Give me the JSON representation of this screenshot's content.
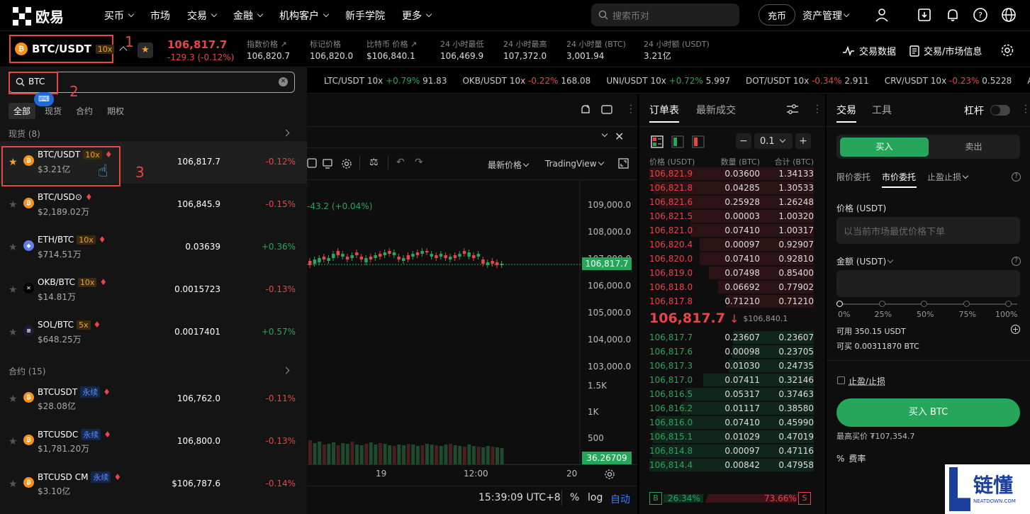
{
  "nav": {
    "brand": "欧易",
    "items": [
      "买币",
      "市场",
      "交易",
      "金融",
      "机构客户",
      "新手学院",
      "更多"
    ],
    "search_placeholder": "搜索币对",
    "charge": "充币",
    "assets": "资产管理"
  },
  "ticker": {
    "pair": "BTC/USDT",
    "leverage": "10x",
    "price": "106,817.7",
    "change": "-129.3 (-0.12%)",
    "stats": [
      {
        "label": "指数价格",
        "value": "106,820.7"
      },
      {
        "label": "标记价格",
        "value": "106,820.0"
      },
      {
        "label": "比特币 价格",
        "value": "$106,840.1"
      },
      {
        "label": "24 小时最低",
        "value": "106,469.9"
      },
      {
        "label": "24 小时最高",
        "value": "107,372.0"
      },
      {
        "label": "24 小时量 (BTC)",
        "value": "3,001.94"
      },
      {
        "label": "24 小时额 (USDT)",
        "value": "3.21亿"
      }
    ],
    "trade_data": "交易数据",
    "market_info": "交易/市场信息"
  },
  "marquee": [
    {
      "pair": "LTC/USDT 10x",
      "chg": "+0.79%",
      "price": "91.83",
      "up": true
    },
    {
      "pair": "OKB/USDT 10x",
      "chg": "-0.22%",
      "price": "168.08",
      "up": false
    },
    {
      "pair": "UNI/USDT 10x",
      "chg": "+0.72%",
      "price": "5.997",
      "up": true
    },
    {
      "pair": "DOT/USDT 10x",
      "chg": "-0.34%",
      "price": "2.911",
      "up": false
    },
    {
      "pair": "CRV/USDT 10x",
      "chg": "-0.23%",
      "price": "0.5228",
      "up": false
    },
    {
      "pair": "AAVE/U",
      "chg": "",
      "price": "",
      "up": true
    }
  ],
  "annotations": [
    "1",
    "2",
    "3"
  ],
  "search": {
    "value": "BTC",
    "tabs": [
      "全部",
      "现货",
      "合约",
      "期权"
    ],
    "spot_header": "现货 (8)",
    "contract_header": "合约 (15)",
    "spot": [
      {
        "name": "BTC/USDT",
        "badge": "10x",
        "vol": "$3.21亿",
        "price": "106,817.7",
        "chg": "-0.12%",
        "up": false,
        "coin": "B",
        "color": "#f7931a",
        "fav": true
      },
      {
        "name": "BTC/USD⊙",
        "badge": "",
        "vol": "$2,189.02万",
        "price": "106,845.9",
        "chg": "-0.15%",
        "up": false,
        "coin": "B",
        "color": "#f7931a",
        "fav": false
      },
      {
        "name": "ETH/BTC",
        "badge": "10x",
        "vol": "$714.51万",
        "price": "0.03639",
        "chg": "+0.36%",
        "up": true,
        "coin": "◆",
        "color": "#627eea",
        "fav": false
      },
      {
        "name": "OKB/BTC",
        "badge": "10x",
        "vol": "$14.81万",
        "price": "0.0015723",
        "chg": "-0.13%",
        "up": false,
        "coin": "✕",
        "color": "#000000",
        "fav": false
      },
      {
        "name": "SOL/BTC",
        "badge": "5x",
        "vol": "$648.25万",
        "price": "0.0017401",
        "chg": "+0.57%",
        "up": true,
        "coin": "≡",
        "color": "#1c1c3a",
        "fav": false
      }
    ],
    "contracts": [
      {
        "name": "BTCUSDT",
        "badge": "永续",
        "vol": "$28.08亿",
        "price": "106,762.0",
        "chg": "-0.11%",
        "up": false
      },
      {
        "name": "BTCUSDC",
        "badge": "永续",
        "vol": "$1,781.20万",
        "price": "106,800.0",
        "chg": "-0.13%",
        "up": false
      },
      {
        "name": "BTCUSD CM",
        "badge": "永续",
        "vol": "$3.10亿",
        "price": "$106,787.6",
        "chg": "-0.14%",
        "up": false
      }
    ]
  },
  "chart": {
    "price_type": "最新价格",
    "view": "TradingView",
    "change_text": "-43.2 (+0.04%)",
    "y_ticks": [
      "109,000.0",
      "108,000.0",
      "107,000.0",
      "106,000.0",
      "105,000.0",
      "104,000.0",
      "103,000.0"
    ],
    "last_price": "106,817.7",
    "vol_ticks": [
      "1.5K",
      "1K",
      "500"
    ],
    "vol_last": "36.26709",
    "x_ticks": [
      "19",
      "12:00",
      "20"
    ],
    "time": "15:39:09 UTC+8",
    "pct": "%",
    "log": "log",
    "auto": "自动"
  },
  "orderbook": {
    "tabs": [
      "订单表",
      "最新成交"
    ],
    "step": "0.1",
    "headers": [
      "价格 (USDT)",
      "数量 (BTC)",
      "合计 (BTC)"
    ],
    "asks": [
      [
        "106,821.9",
        "0.03600",
        "1.34133"
      ],
      [
        "106,821.8",
        "0.04285",
        "1.30533"
      ],
      [
        "106,821.6",
        "0.25928",
        "1.26248"
      ],
      [
        "106,821.5",
        "0.00003",
        "1.00320"
      ],
      [
        "106,821.0",
        "0.07410",
        "1.00317"
      ],
      [
        "106,820.4",
        "0.00097",
        "0.92907"
      ],
      [
        "106,820.0",
        "0.07410",
        "0.92810"
      ],
      [
        "106,819.0",
        "0.07498",
        "0.85400"
      ],
      [
        "106,818.0",
        "0.06692",
        "0.77902"
      ],
      [
        "106,817.8",
        "0.71210",
        "0.71210"
      ]
    ],
    "mid_price": "106,817.7",
    "mid_sub": "$106,840.1",
    "bids": [
      [
        "106,817.7",
        "0.23607",
        "0.23607"
      ],
      [
        "106,817.6",
        "0.00098",
        "0.23705"
      ],
      [
        "106,817.3",
        "0.01030",
        "0.24735"
      ],
      [
        "106,817.0",
        "0.07411",
        "0.32146"
      ],
      [
        "106,816.5",
        "0.05317",
        "0.37463"
      ],
      [
        "106,816.2",
        "0.01117",
        "0.38580"
      ],
      [
        "106,816.0",
        "0.07410",
        "0.45990"
      ],
      [
        "106,815.1",
        "0.01029",
        "0.47019"
      ],
      [
        "106,814.8",
        "0.00097",
        "0.47116"
      ],
      [
        "106,814.4",
        "0.00842",
        "0.47958"
      ]
    ],
    "buy_ratio": "26.34%",
    "sell_ratio": "73.66%",
    "b": "B",
    "s": "S"
  },
  "trade": {
    "tabs": [
      "交易",
      "工具"
    ],
    "leverage": "杠杆",
    "buy": "买入",
    "sell": "卖出",
    "order_types": [
      "限价委托",
      "市价委托",
      "止盈止损"
    ],
    "price_label": "价格 (USDT)",
    "price_placeholder": "以当前市场最优价格下单",
    "amount_label": "金额 (USDT)",
    "slider_ticks": [
      "0%",
      "25%",
      "50%",
      "75%",
      "100%"
    ],
    "available": "可用 350.15 USDT",
    "can_buy": "可买 0.00311870 BTC",
    "tpsl": "止盈/止损",
    "buy_btn": "买入 BTC",
    "max_buy": "最高买价 ₮107,354.7",
    "fee": "费率"
  },
  "watermark": {
    "cn": "链懂",
    "en": "NEATDOWN.COM"
  },
  "colors": {
    "up": "#26a65b",
    "down": "#e64646",
    "accent_green": "#26a65b"
  }
}
